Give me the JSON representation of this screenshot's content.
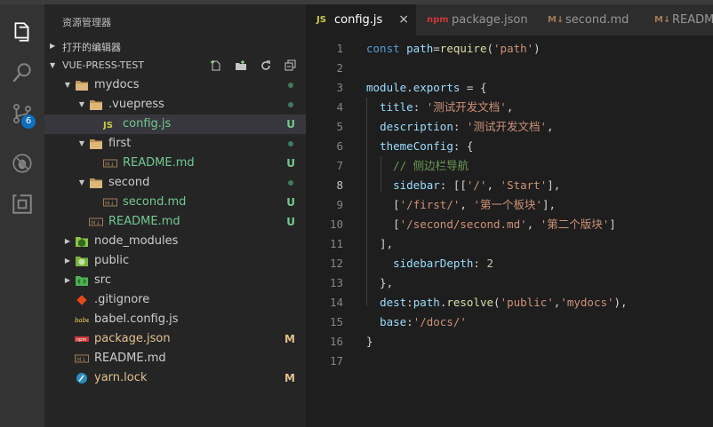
{
  "sidebar": {
    "title": "资源管理器",
    "open_editors": "打开的编辑器",
    "project": "VUE-PRESS-TEST",
    "tree": [
      {
        "name": "mydocs",
        "depth": 1,
        "type": "folder",
        "open": true,
        "status": "dot",
        "icon": "folder-icon"
      },
      {
        "name": ".vuepress",
        "depth": 2,
        "type": "folder",
        "open": true,
        "status": "dot",
        "icon": "folder-icon"
      },
      {
        "name": "config.js",
        "depth": 3,
        "type": "file",
        "status": "U",
        "icon": "js-file-icon",
        "selected": true
      },
      {
        "name": "first",
        "depth": 2,
        "type": "folder",
        "open": true,
        "status": "dot",
        "icon": "folder-icon"
      },
      {
        "name": "README.md",
        "depth": 3,
        "type": "file",
        "status": "U",
        "icon": "markdown-file-icon"
      },
      {
        "name": "second",
        "depth": 2,
        "type": "folder",
        "open": true,
        "status": "dot",
        "icon": "folder-icon"
      },
      {
        "name": "second.md",
        "depth": 3,
        "type": "file",
        "status": "U",
        "icon": "markdown-file-icon"
      },
      {
        "name": "README.md",
        "depth": 2,
        "type": "file",
        "status": "U",
        "icon": "markdown-file-icon"
      },
      {
        "name": "node_modules",
        "depth": 1,
        "type": "folder",
        "open": false,
        "status": "",
        "icon": "node-modules-folder-icon"
      },
      {
        "name": "public",
        "depth": 1,
        "type": "folder",
        "open": false,
        "status": "",
        "icon": "public-folder-icon"
      },
      {
        "name": "src",
        "depth": 1,
        "type": "folder",
        "open": false,
        "status": "",
        "icon": "src-folder-icon"
      },
      {
        "name": ".gitignore",
        "depth": 1,
        "type": "file",
        "status": "",
        "icon": "git-file-icon"
      },
      {
        "name": "babel.config.js",
        "depth": 1,
        "type": "file",
        "status": "",
        "icon": "babel-file-icon"
      },
      {
        "name": "package.json",
        "depth": 1,
        "type": "file",
        "status": "M",
        "icon": "npm-file-icon"
      },
      {
        "name": "README.md",
        "depth": 1,
        "type": "file",
        "status": "",
        "icon": "markdown-file-icon"
      },
      {
        "name": "yarn.lock",
        "depth": 1,
        "type": "file",
        "status": "M",
        "icon": "yarn-file-icon"
      }
    ]
  },
  "activity": {
    "scm_badge": "6"
  },
  "tabs": [
    {
      "icon_text": "JS",
      "label": "config.js",
      "active": true,
      "close": "×"
    },
    {
      "icon_text": "npm",
      "label": "package.json",
      "active": false
    },
    {
      "icon_text": "M↓",
      "label": "second.md",
      "active": false
    },
    {
      "icon_text": "M↓",
      "label": "READM",
      "active": false
    }
  ],
  "editor": {
    "current_line": 8,
    "lines": [
      [
        [
          "kw",
          "const "
        ],
        [
          "var",
          "path"
        ],
        [
          "pl",
          "="
        ],
        [
          "fn",
          "require"
        ],
        [
          "pl",
          "("
        ],
        [
          "str",
          "'path'"
        ],
        [
          "pl",
          ")"
        ]
      ],
      [],
      [
        [
          "var",
          "module"
        ],
        [
          "pl",
          "."
        ],
        [
          "var",
          "exports"
        ],
        [
          "pl",
          " = {"
        ]
      ],
      [
        [
          "pl",
          "  "
        ],
        [
          "var",
          "title"
        ],
        [
          "pl",
          ": "
        ],
        [
          "str",
          "'测试开发文档'"
        ],
        [
          "pl",
          ","
        ]
      ],
      [
        [
          "pl",
          "  "
        ],
        [
          "var",
          "description"
        ],
        [
          "pl",
          ": "
        ],
        [
          "str",
          "'测试开发文档'"
        ],
        [
          "pl",
          ","
        ]
      ],
      [
        [
          "pl",
          "  "
        ],
        [
          "var",
          "themeConfig"
        ],
        [
          "pl",
          ": {"
        ]
      ],
      [
        [
          "pl",
          "    "
        ],
        [
          "cm",
          "// 侧边栏导航"
        ]
      ],
      [
        [
          "pl",
          "    "
        ],
        [
          "var",
          "sidebar"
        ],
        [
          "pl",
          ": [["
        ],
        [
          "str",
          "'/'"
        ],
        [
          "pl",
          ", "
        ],
        [
          "str",
          "'Start'"
        ],
        [
          "pl",
          "],"
        ]
      ],
      [
        [
          "pl",
          "    ["
        ],
        [
          "str",
          "'/first/'"
        ],
        [
          "pl",
          ", "
        ],
        [
          "str",
          "'第一个板块'"
        ],
        [
          "pl",
          "],"
        ]
      ],
      [
        [
          "pl",
          "    ["
        ],
        [
          "str",
          "'/second/second.md'"
        ],
        [
          "pl",
          ", "
        ],
        [
          "str",
          "'第二个版块'"
        ],
        [
          "pl",
          "]"
        ]
      ],
      [
        [
          "pl",
          "  ],"
        ]
      ],
      [
        [
          "pl",
          "    "
        ],
        [
          "var",
          "sidebarDepth"
        ],
        [
          "pl",
          ": "
        ],
        [
          "num",
          "2"
        ]
      ],
      [
        [
          "pl",
          "  },"
        ]
      ],
      [
        [
          "pl",
          "  "
        ],
        [
          "var",
          "dest"
        ],
        [
          "pl",
          ":"
        ],
        [
          "var",
          "path"
        ],
        [
          "pl",
          "."
        ],
        [
          "fn",
          "resolve"
        ],
        [
          "pl",
          "("
        ],
        [
          "str",
          "'public'"
        ],
        [
          "pl",
          ","
        ],
        [
          "str",
          "'mydocs'"
        ],
        [
          "pl",
          "),"
        ]
      ],
      [
        [
          "pl",
          "  "
        ],
        [
          "var",
          "base"
        ],
        [
          "pl",
          ":"
        ],
        [
          "str",
          "'/docs/'"
        ]
      ],
      [
        [
          "pl",
          "}"
        ]
      ],
      []
    ]
  },
  "colors": {
    "status_untracked": "#73c991",
    "status_modified": "#e2c08d",
    "selection": "#37373d"
  }
}
